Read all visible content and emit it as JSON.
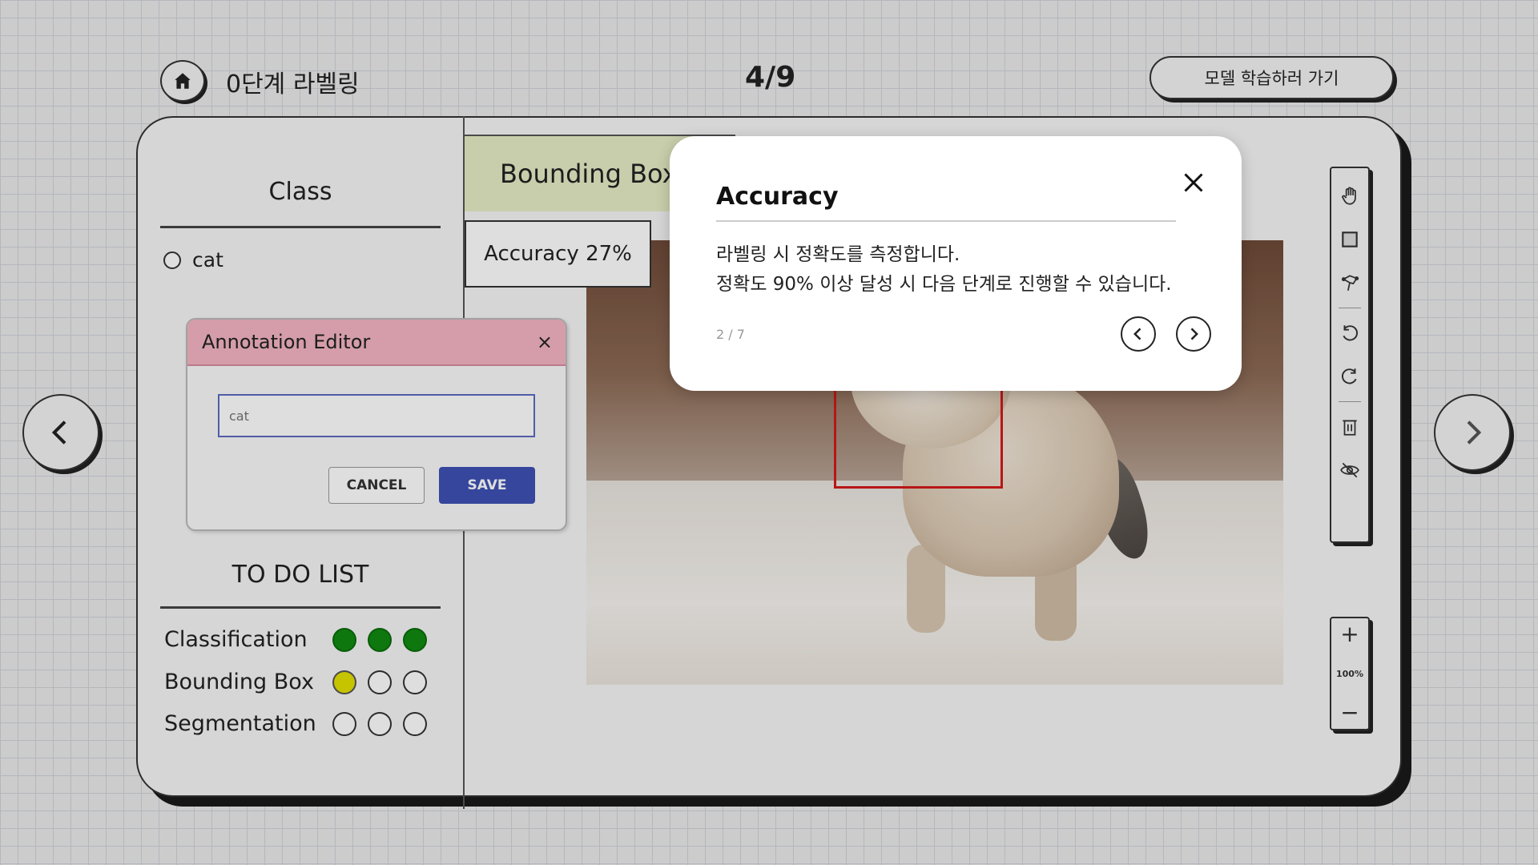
{
  "header": {
    "stage_title": "0단계 라벨링",
    "page_counter": "4/9",
    "go_train_label": "모델 학습하러 가기",
    "home_icon": "home-icon"
  },
  "sidebar": {
    "class_title": "Class",
    "class_options": [
      {
        "label": "cat",
        "selected": false
      }
    ],
    "todo_title": "TO DO LIST",
    "todo_items": [
      {
        "label": "Classification",
        "progress": [
          "done",
          "done",
          "done"
        ]
      },
      {
        "label": "Bounding Box",
        "progress": [
          "current",
          "empty",
          "empty"
        ]
      },
      {
        "label": "Segmentation",
        "progress": [
          "empty",
          "empty",
          "empty"
        ]
      }
    ]
  },
  "annotation_editor": {
    "title": "Annotation Editor",
    "input_placeholder": "cat",
    "cancel_label": "CANCEL",
    "save_label": "SAVE",
    "header_color": "#f4b5c3",
    "save_color": "#3f51b5"
  },
  "workspace": {
    "mode_tab": "Bounding Box",
    "accuracy_label": "Accuracy 27%",
    "annotation_color": "#d31a1a"
  },
  "toolbar": {
    "tools": [
      "hand-icon",
      "square-icon",
      "polygon-icon",
      "undo-icon",
      "redo-icon",
      "trash-icon",
      "eye-off-icon"
    ],
    "zoom_in": "+",
    "zoom_level": "100%",
    "zoom_out": "−"
  },
  "modal": {
    "title": "Accuracy",
    "body_line1": "라벨링 시 정확도를 측정합니다.",
    "body_line2": "정확도 90% 이상 달성 시 다음 단계로 진행할 수 있습니다.",
    "counter": "2 / 7"
  },
  "colors": {
    "done": "#118a11",
    "current": "#e4e000",
    "board_bg": "#f6f6f6"
  }
}
